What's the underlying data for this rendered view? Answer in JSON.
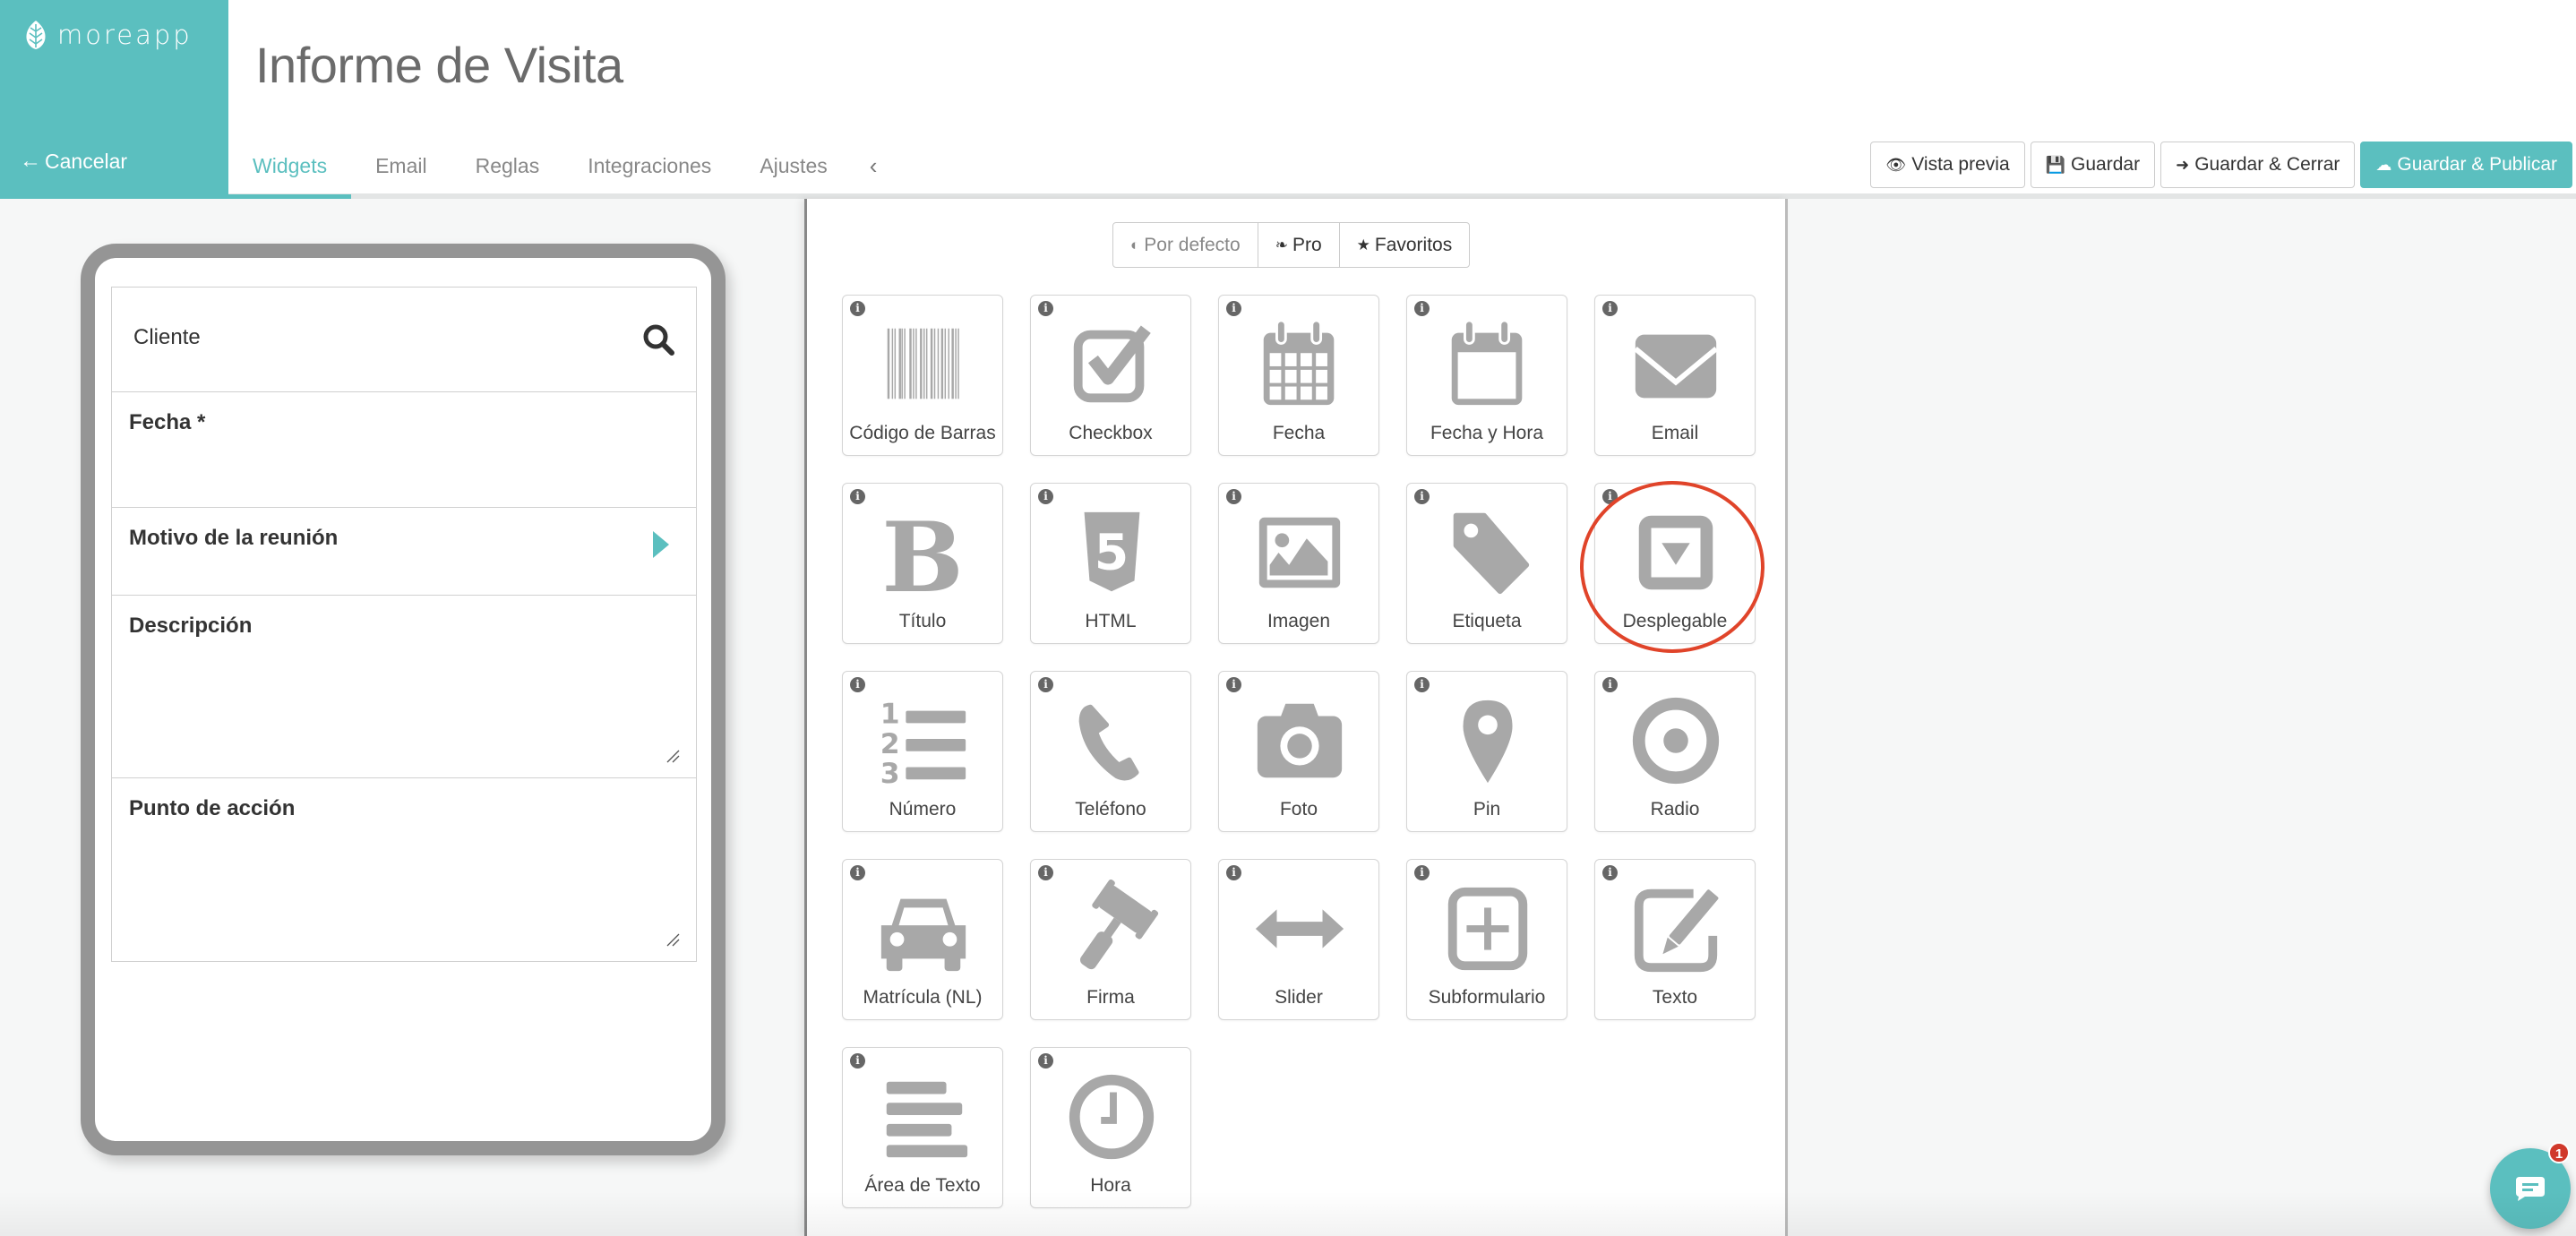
{
  "brand": {
    "logo_text": "moreapp",
    "cancel_label": "Cancelar"
  },
  "header": {
    "title": "Informe de Visita",
    "tabs": [
      {
        "label": "Widgets",
        "active": true
      },
      {
        "label": "Email"
      },
      {
        "label": "Reglas"
      },
      {
        "label": "Integraciones"
      },
      {
        "label": "Ajustes"
      }
    ],
    "actions": {
      "preview": "Vista previa",
      "save": "Guardar",
      "save_close": "Guardar & Cerrar",
      "save_publish": "Guardar & Publicar"
    }
  },
  "form_preview": {
    "fields": [
      {
        "label": "Cliente",
        "type": "search"
      },
      {
        "label": "Fecha *",
        "type": "date"
      },
      {
        "label": "Motivo de la reunión",
        "type": "select"
      },
      {
        "label": "Descripción",
        "type": "textarea"
      },
      {
        "label": "Punto de acción",
        "type": "textarea"
      }
    ]
  },
  "widget_panel": {
    "categories": [
      {
        "label": "Por defecto",
        "icon": "dashboard-icon"
      },
      {
        "label": "Pro",
        "icon": "leaf-icon"
      },
      {
        "label": "Favoritos",
        "icon": "star-icon"
      }
    ],
    "info_glyph": "i",
    "widgets": [
      {
        "label": "Código de Barras",
        "icon": "barcode-icon"
      },
      {
        "label": "Checkbox",
        "icon": "checkbox-icon"
      },
      {
        "label": "Fecha",
        "icon": "calendar-icon"
      },
      {
        "label": "Fecha y Hora",
        "icon": "calendar-blank-icon"
      },
      {
        "label": "Email",
        "icon": "envelope-icon"
      },
      {
        "label": "Título",
        "icon": "bold-icon"
      },
      {
        "label": "HTML",
        "icon": "html5-icon"
      },
      {
        "label": "Imagen",
        "icon": "image-icon"
      },
      {
        "label": "Etiqueta",
        "icon": "tag-icon"
      },
      {
        "label": "Desplegable",
        "icon": "dropdown-icon",
        "highlighted": true
      },
      {
        "label": "Número",
        "icon": "ordered-list-icon"
      },
      {
        "label": "Teléfono",
        "icon": "phone-icon"
      },
      {
        "label": "Foto",
        "icon": "camera-icon"
      },
      {
        "label": "Pin",
        "icon": "map-marker-icon"
      },
      {
        "label": "Radio",
        "icon": "radio-icon"
      },
      {
        "label": "Matrícula (NL)",
        "icon": "car-icon"
      },
      {
        "label": "Firma",
        "icon": "gavel-icon"
      },
      {
        "label": "Slider",
        "icon": "arrows-horizontal-icon"
      },
      {
        "label": "Subformulario",
        "icon": "plus-square-icon"
      },
      {
        "label": "Texto",
        "icon": "edit-icon"
      },
      {
        "label": "Área de Texto",
        "icon": "align-left-icon"
      },
      {
        "label": "Hora",
        "icon": "clock-icon"
      }
    ]
  },
  "chat": {
    "badge_count": "1"
  },
  "colors": {
    "brand": "#5bbfbf",
    "highlight": "#e0442a",
    "icon_gray": "#a8a8a8"
  }
}
